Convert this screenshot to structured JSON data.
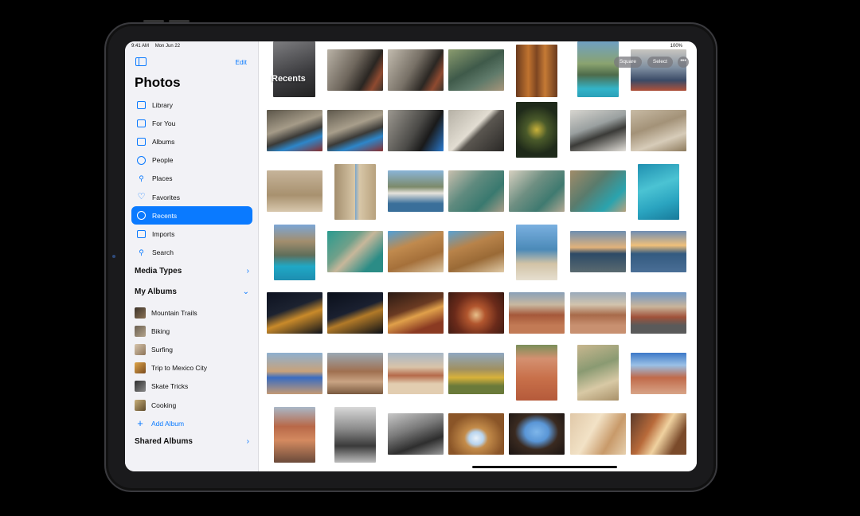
{
  "status": {
    "time": "9:41 AM",
    "date": "Mon Jun 22",
    "battery": "100%"
  },
  "sidebar": {
    "edit_label": "Edit",
    "title": "Photos",
    "items": [
      {
        "label": "Library",
        "icon": "library-icon"
      },
      {
        "label": "For You",
        "icon": "for-you-icon"
      },
      {
        "label": "Albums",
        "icon": "albums-icon"
      },
      {
        "label": "People",
        "icon": "people-icon"
      },
      {
        "label": "Places",
        "icon": "places-icon"
      },
      {
        "label": "Favorites",
        "icon": "heart-icon"
      },
      {
        "label": "Recents",
        "icon": "clock-icon",
        "active": true
      },
      {
        "label": "Imports",
        "icon": "imports-icon"
      },
      {
        "label": "Search",
        "icon": "search-icon"
      }
    ],
    "media_types_label": "Media Types",
    "my_albums_label": "My Albums",
    "albums": [
      {
        "label": "Mountain Trails",
        "color": "#6b5a45"
      },
      {
        "label": "Biking",
        "color": "#8a7a66"
      },
      {
        "label": "Surfing",
        "color": "#b7a48a"
      },
      {
        "label": "Trip to Mexico City",
        "color": "#c79a3a"
      },
      {
        "label": "Skate Tricks",
        "color": "#5e5e5e"
      },
      {
        "label": "Cooking",
        "color": "#a08a58"
      }
    ],
    "add_album_label": "Add Album",
    "shared_albums_label": "Shared Albums"
  },
  "main": {
    "title": "Recents",
    "square_label": "Square",
    "select_label": "Select",
    "more_label": "•••"
  },
  "colors": {
    "accent": "#0a7aff"
  }
}
